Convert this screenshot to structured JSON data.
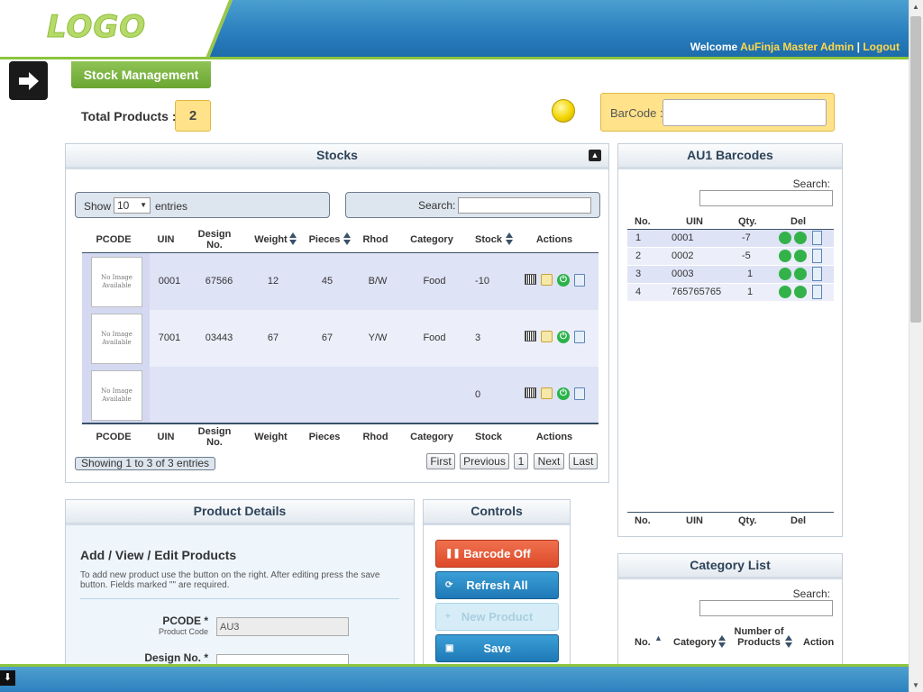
{
  "header": {
    "logo": "LOGO",
    "welcome_prefix": "Welcome",
    "user": "AuFinja Master Admin",
    "separator": "|",
    "logout": "Logout"
  },
  "nav": {
    "tab": "Stock Management"
  },
  "summary": {
    "total_label": "Total Products :",
    "total_value": "2"
  },
  "barcode": {
    "label": "BarCode :",
    "value": ""
  },
  "stocks": {
    "title": "Stocks",
    "show": "Show",
    "length_value": "10",
    "entries": "entries",
    "search_label": "Search:",
    "columns": [
      "PCODE",
      "UIN",
      "Design No.",
      "Weight",
      "Pieces",
      "Rhod",
      "Category",
      "Stock",
      "Actions"
    ],
    "footer_columns": [
      "PCODE",
      "UIN",
      "Design No.",
      "Weight",
      "Pieces",
      "Rhod",
      "Category",
      "Stock",
      "Actions"
    ],
    "rows": [
      {
        "image": "No Image Available",
        "uin": "0001",
        "design": "67566",
        "weight": "12",
        "pieces": "45",
        "rhod": "B/W",
        "category": "Food",
        "stock": "-10"
      },
      {
        "image": "No Image Available",
        "uin": "7001",
        "design": "03443",
        "weight": "67",
        "pieces": "67",
        "rhod": "Y/W",
        "category": "Food",
        "stock": "3"
      },
      {
        "image": "No Image Available",
        "uin": "",
        "design": "",
        "weight": "",
        "pieces": "",
        "rhod": "",
        "category": "",
        "stock": "0"
      }
    ],
    "info": "Showing 1 to 3 of 3 entries",
    "pagination": {
      "first": "First",
      "previous": "Previous",
      "page": "1",
      "next": "Next",
      "last": "Last"
    }
  },
  "au1": {
    "title": "AU1 Barcodes",
    "search_label": "Search:",
    "columns": [
      "No.",
      "UIN",
      "Qty.",
      "Del"
    ],
    "rows": [
      {
        "no": "1",
        "uin": "0001",
        "qty": "-7"
      },
      {
        "no": "2",
        "uin": "0002",
        "qty": "-5"
      },
      {
        "no": "3",
        "uin": "0003",
        "qty": "1"
      },
      {
        "no": "4",
        "uin": "765765765",
        "qty": "1"
      }
    ],
    "footer_columns": [
      "No.",
      "UIN",
      "Qty.",
      "Del"
    ]
  },
  "product": {
    "title": "Product Details",
    "subtitle": "Add / View / Edit Products",
    "description": "To add new product use the button on the right. After editing press the save button. Fields marked \"\" are required.",
    "pcode_label": "PCODE *",
    "pcode_sub": "Product Code",
    "pcode_value": "AU3",
    "design_label": "Design No. *"
  },
  "controls": {
    "title": "Controls",
    "barcode_off": "Barcode Off",
    "refresh_all": "Refresh All",
    "new_product": "New Product",
    "save": "Save"
  },
  "category": {
    "title": "Category List",
    "search_label": "Search:",
    "col_no": "No.",
    "col_category": "Category",
    "col_number": "Number of Products",
    "col_action": "Action"
  },
  "colors": {
    "accent_green": "#8cc43c",
    "header_blue": "#2a7fbe",
    "highlight_yellow": "#ffe28a",
    "barcode_off_red": "#e85a3a"
  }
}
